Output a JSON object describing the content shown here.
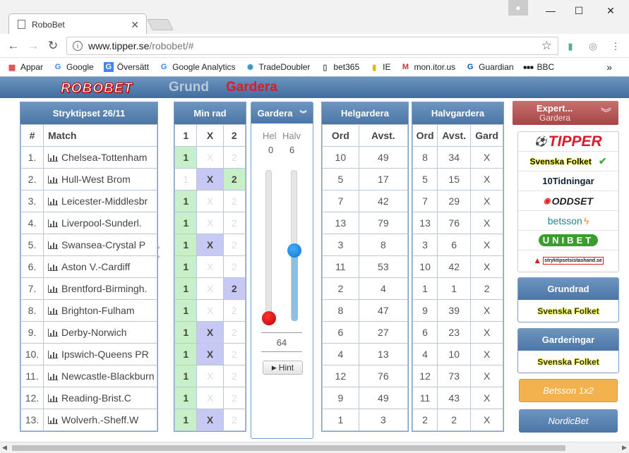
{
  "browser": {
    "tab_title": "RoboBet",
    "url_host": "www.tipper.se",
    "url_path": "/robobet/#",
    "bookmarks": [
      "Appar",
      "Google",
      "Översätt",
      "Google Analytics",
      "TradeDoubler",
      "bet365",
      "IE",
      "mon.itor.us",
      "Guardian",
      "BBC"
    ],
    "more": "»"
  },
  "app": {
    "logo": "ROBOBET",
    "mode_grund": "Grund",
    "mode_gardera": "Gardera"
  },
  "stryktips": {
    "title": "Stryktipset 26/11",
    "col_num": "#",
    "col_match": "Match",
    "rows": [
      {
        "n": "1.",
        "match": "Chelsea-Tottenham"
      },
      {
        "n": "2.",
        "match": "Hull-West Brom"
      },
      {
        "n": "3.",
        "match": "Leicester-Middlesbr"
      },
      {
        "n": "4.",
        "match": "Liverpool-Sunderl."
      },
      {
        "n": "5.",
        "match": "Swansea-Crystal P"
      },
      {
        "n": "6.",
        "match": "Aston V.-Cardiff"
      },
      {
        "n": "7.",
        "match": "Brentford-Birmingh."
      },
      {
        "n": "8.",
        "match": "Brighton-Fulham"
      },
      {
        "n": "9.",
        "match": "Derby-Norwich"
      },
      {
        "n": "10.",
        "match": "Ipswich-Queens PR"
      },
      {
        "n": "11.",
        "match": "Newcastle-Blackburn"
      },
      {
        "n": "12.",
        "match": "Reading-Brist.C"
      },
      {
        "n": "13.",
        "match": "Wolverh.-Sheff.W"
      }
    ]
  },
  "minrad": {
    "title": "Min rad",
    "cols": [
      "1",
      "X",
      "2"
    ],
    "rows": [
      [
        "g1",
        "oX",
        "o2"
      ],
      [
        "o1",
        "pX",
        "g2"
      ],
      [
        "g1",
        "oX",
        "o2"
      ],
      [
        "g1",
        "oX",
        "o2"
      ],
      [
        "g1",
        "pX",
        "o2"
      ],
      [
        "g1",
        "oX",
        "o2"
      ],
      [
        "g1",
        "oX",
        "p2"
      ],
      [
        "g1",
        "oX",
        "o2"
      ],
      [
        "g1",
        "pX",
        "o2"
      ],
      [
        "g1",
        "pX",
        "o2"
      ],
      [
        "g1",
        "oX",
        "o2"
      ],
      [
        "g1",
        "oX",
        "o2"
      ],
      [
        "g1",
        "pX",
        "o2"
      ]
    ]
  },
  "gardera": {
    "title": "Gardera",
    "label_hel": "Hel",
    "label_halv": "Halv",
    "hel_value": "0",
    "halv_value": "6",
    "total": "64",
    "hint": "Hint",
    "hel_level": 0,
    "halv_level": 0.6
  },
  "helgardera": {
    "title": "Helgardera",
    "cols": [
      "Ord",
      "Avst."
    ],
    "rows": [
      [
        "10",
        "49"
      ],
      [
        "5",
        "17"
      ],
      [
        "7",
        "42"
      ],
      [
        "13",
        "79"
      ],
      [
        "3",
        "8"
      ],
      [
        "11",
        "53"
      ],
      [
        "2",
        "4"
      ],
      [
        "8",
        "47"
      ],
      [
        "6",
        "27"
      ],
      [
        "4",
        "13"
      ],
      [
        "12",
        "76"
      ],
      [
        "9",
        "49"
      ],
      [
        "1",
        "3"
      ]
    ]
  },
  "halvgardera": {
    "title": "Halvgardera",
    "cols": [
      "Ord",
      "Avst.",
      "Gard"
    ],
    "rows": [
      [
        "8",
        "34",
        "X"
      ],
      [
        "5",
        "15",
        "X"
      ],
      [
        "7",
        "29",
        "X"
      ],
      [
        "13",
        "76",
        "X"
      ],
      [
        "3",
        "6",
        "X"
      ],
      [
        "10",
        "42",
        "X"
      ],
      [
        "1",
        "1",
        "2"
      ],
      [
        "9",
        "39",
        "X"
      ],
      [
        "6",
        "23",
        "X"
      ],
      [
        "4",
        "10",
        "X"
      ],
      [
        "12",
        "73",
        "X"
      ],
      [
        "11",
        "43",
        "X"
      ],
      [
        "2",
        "2",
        "X"
      ]
    ]
  },
  "expert": {
    "title": "Expert...",
    "subtitle": "Gardera",
    "sources": [
      "TIPPER",
      "Svenska Folket",
      "10Tidningar",
      "ODDSET",
      "betsson",
      "UNIBET",
      "stryktipsetsistashand.se"
    ],
    "checked": "✔",
    "grundrad_title": "Grundrad",
    "grundrad_value": "Svenska Folket",
    "garderingar_title": "Garderingar",
    "garderingar_value": "Svenska Folket",
    "betsson_btn": "Betsson 1x2",
    "nordic_btn": "NordicBet"
  },
  "colors": {
    "header_blue": "#4b76a6",
    "green": "#c8f0c8",
    "purple": "#c8c8f5",
    "red": "#cc1111"
  }
}
